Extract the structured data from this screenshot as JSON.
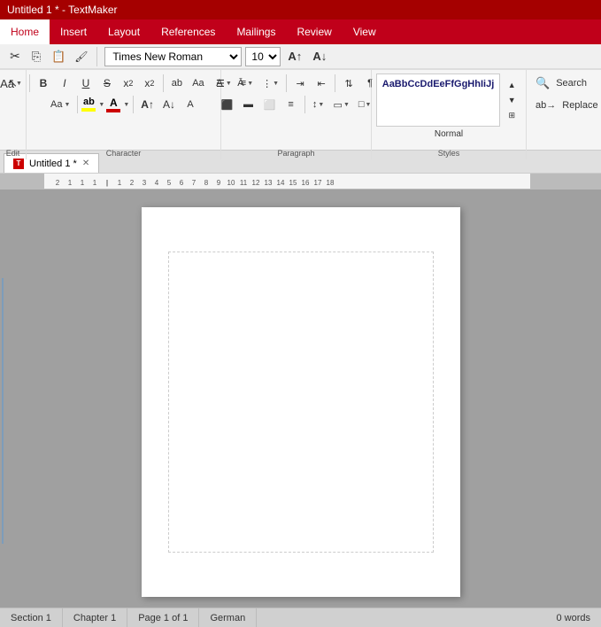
{
  "titlebar": {
    "title": "Untitled 1 * - TextMaker"
  },
  "menubar": {
    "items": [
      "Home",
      "Insert",
      "Layout",
      "References",
      "Mailings",
      "Review",
      "View"
    ],
    "active": "Home"
  },
  "quickaccess": {
    "buttons": [
      "✦",
      "📄",
      "📁",
      "💾",
      "↩",
      "↪"
    ]
  },
  "ribbon": {
    "edit_section": "Edit",
    "char_section": "Character",
    "para_section": "Paragraph",
    "styles_section": "Styles",
    "font": {
      "name": "Times New Roman",
      "size": "10"
    },
    "bold": "B",
    "italic": "I",
    "underline": "U",
    "strikethrough": "S",
    "subscript": "x",
    "superscript": "x",
    "style_preview_text": "AaBbCcDdEeFfGgHhIiJj",
    "style_name": "Normal",
    "search_label": "Search",
    "replace_label": "Replace"
  },
  "tab": {
    "label": "Untitled 1 *",
    "icon": "T"
  },
  "ruler": {
    "marks": [
      "2",
      "1",
      "1",
      "1",
      "2",
      "3",
      "4",
      "5",
      "6",
      "7",
      "8",
      "9",
      "10",
      "11",
      "12",
      "13",
      "14",
      "15",
      "16",
      "17",
      "18"
    ]
  },
  "statusbar": {
    "section": "Section 1",
    "chapter": "Chapter 1",
    "page": "Page 1 of 1",
    "language": "German",
    "words": "0 words"
  }
}
